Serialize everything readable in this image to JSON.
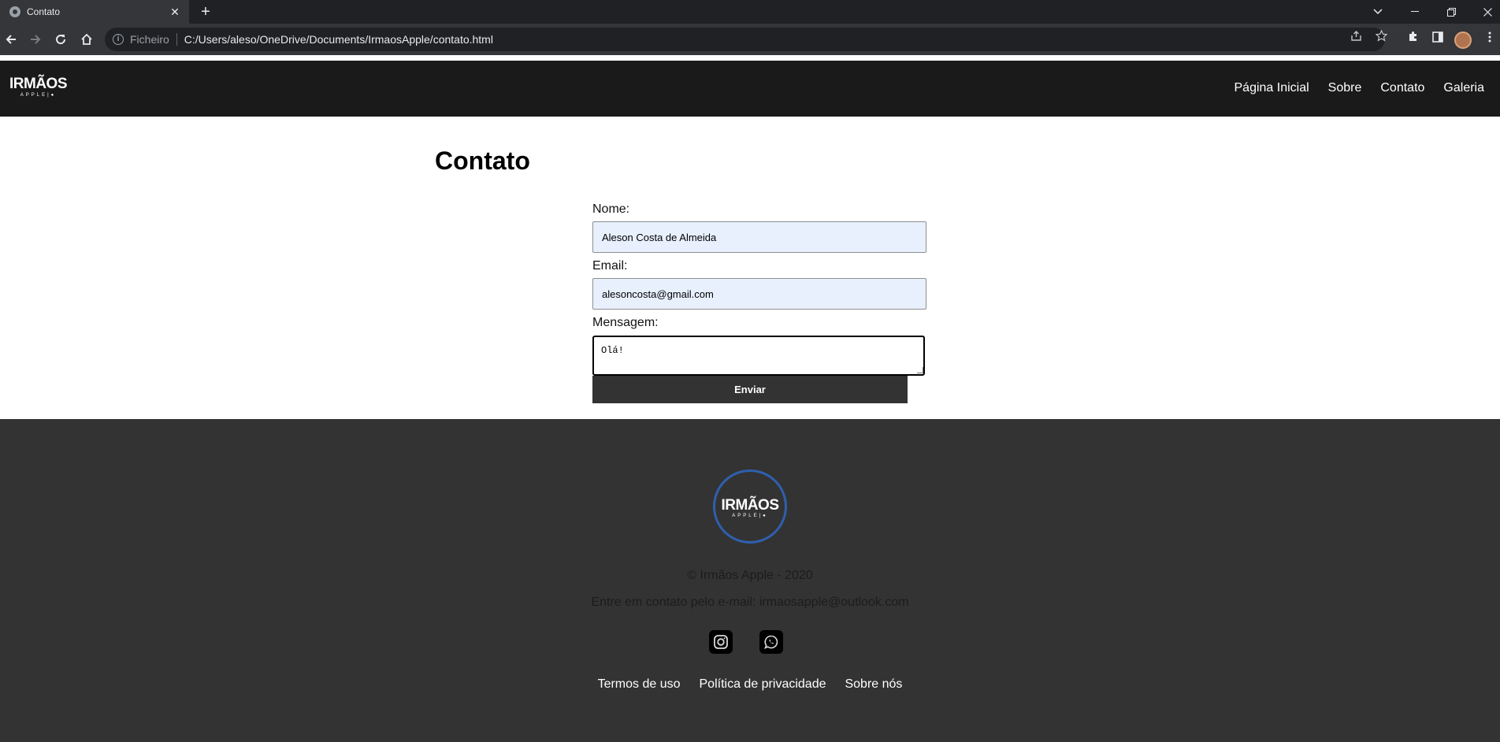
{
  "browser": {
    "tab_title": "Contato",
    "tab_close": "✕",
    "new_tab": "+",
    "scheme_label": "Ficheiro",
    "url": "C:/Users/aleso/OneDrive/Documents/IrmaosApple/contato.html"
  },
  "site": {
    "logo_text": "IRMÃOS",
    "logo_sub": "APPLE|",
    "nav": [
      "Página Inicial",
      "Sobre",
      "Contato",
      "Galeria"
    ]
  },
  "main": {
    "title": "Contato",
    "name_label": "Nome:",
    "name_value": "Aleson Costa de Almeida",
    "email_label": "Email:",
    "email_value": "alesoncosta@gmail.com",
    "message_label": "Mensagem:",
    "message_value": "Olá!",
    "submit_label": "Enviar"
  },
  "footer": {
    "logo_text": "IRMÃOS",
    "logo_sub": "APPLE|",
    "copyright": "© Irmãos Apple - 2020",
    "contact": "Entre em contato pelo e-mail: irmaosapple@outlook.com",
    "social_icons": [
      "instagram-icon",
      "whatsapp-icon"
    ],
    "links": [
      "Termos de uso",
      "Política de privacidade",
      "Sobre nós"
    ]
  },
  "colors": {
    "header_bg": "#1a1a1a",
    "footer_bg": "#333333",
    "button_bg": "#333333",
    "autofill_bg": "#e8f0fe",
    "logo_ring": "#2f5fae"
  }
}
